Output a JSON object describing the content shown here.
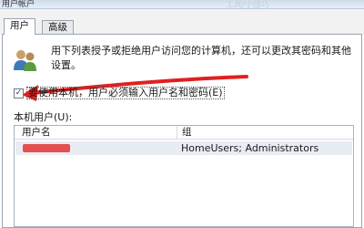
{
  "window": {
    "title": "用户帐户",
    "watermark": "工具/小技巧"
  },
  "tabs": [
    {
      "label": "用户",
      "active": true
    },
    {
      "label": "高级",
      "active": false
    }
  ],
  "description": "用下列表授予或拒绝用户访问您的计算机，还可以更改其密码和其他设置。",
  "require_password": {
    "label": "要使用本机，用户必须输入用户名和密码(E)",
    "checked": true,
    "check_glyph": "✓"
  },
  "local_users": {
    "label": "本机用户(U):",
    "columns": [
      "用户名",
      "组"
    ],
    "rows": [
      {
        "name_redacted": true,
        "group": "HomeUsers; Administrators"
      }
    ]
  },
  "colors": {
    "arrow": "#e02020",
    "redaction": "#e34f4f"
  }
}
